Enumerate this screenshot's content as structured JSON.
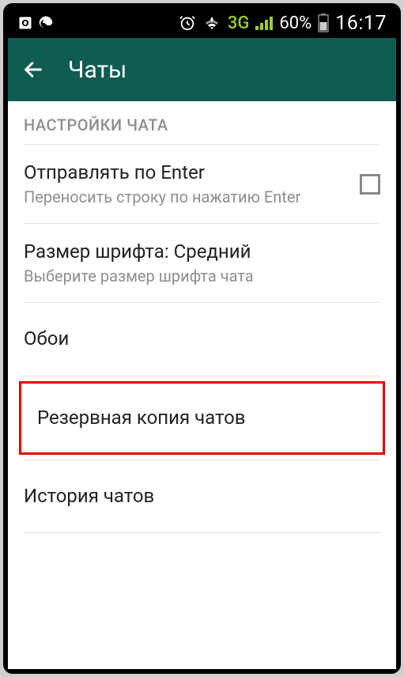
{
  "status_bar": {
    "network_label": "3G",
    "battery_pct": "60%",
    "time": "16:17"
  },
  "header": {
    "title": "Чаты"
  },
  "settings": {
    "section_header": "НАСТРОЙКИ ЧАТА",
    "send_on_enter": {
      "title": "Отправлять по Enter",
      "subtitle": "Переносить строку по нажатию Enter"
    },
    "font_size": {
      "title": "Размер шрифта: Средний",
      "subtitle": "Выберите размер шрифта чата"
    },
    "wallpaper": {
      "title": "Обои"
    },
    "backup": {
      "title": "Резервная копия чатов"
    },
    "history": {
      "title": "История чатов"
    }
  }
}
